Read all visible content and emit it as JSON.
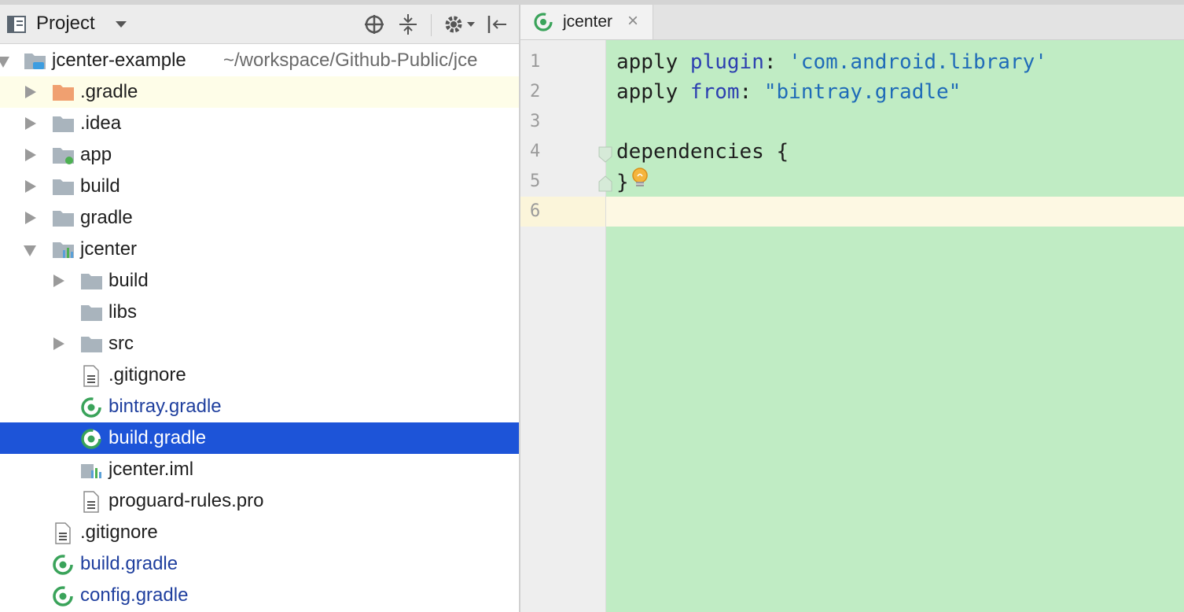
{
  "project_panel": {
    "title": "Project",
    "icons": [
      "project-view-icon",
      "dropdown-arrow-icon",
      "locate-icon",
      "collapse-all-icon",
      "gear-icon",
      "hide-panel-icon"
    ]
  },
  "tree": {
    "root": {
      "label": "jcenter-example",
      "path": "~/workspace/Github-Public/jce"
    },
    "items": [
      {
        "label": ".gradle"
      },
      {
        "label": ".idea"
      },
      {
        "label": "app"
      },
      {
        "label": "build"
      },
      {
        "label": "gradle"
      },
      {
        "label": "jcenter"
      },
      {
        "label": "build"
      },
      {
        "label": "libs"
      },
      {
        "label": "src"
      },
      {
        "label": ".gitignore"
      },
      {
        "label": "bintray.gradle"
      },
      {
        "label": "build.gradle"
      },
      {
        "label": "jcenter.iml"
      },
      {
        "label": "proguard-rules.pro"
      },
      {
        "label": ".gitignore"
      },
      {
        "label": "build.gradle"
      },
      {
        "label": "config.gradle"
      }
    ]
  },
  "editor": {
    "tab_label": "jcenter",
    "tab_close": "×",
    "line_numbers": [
      "1",
      "2",
      "3",
      "4",
      "5",
      "6"
    ],
    "lines": [
      {
        "a": "apply ",
        "b": "plugin",
        "c": ": ",
        "d": "'com.android.library'"
      },
      {
        "a": "apply ",
        "b": "from",
        "c": ": ",
        "d": "\"bintray.gradle\""
      },
      {
        "a": ""
      },
      {
        "a": "dependencies {"
      },
      {
        "a": "}"
      },
      {
        "a": ""
      }
    ]
  },
  "colors": {
    "selection": "#1d54d8",
    "editor_background": "#c0ecc4",
    "gradle_file_text": "#1f3f9e",
    "folder": "#a9b4bd",
    "excluded_folder": "#f0a070",
    "gradle_icon_green": "#3aa35a"
  }
}
